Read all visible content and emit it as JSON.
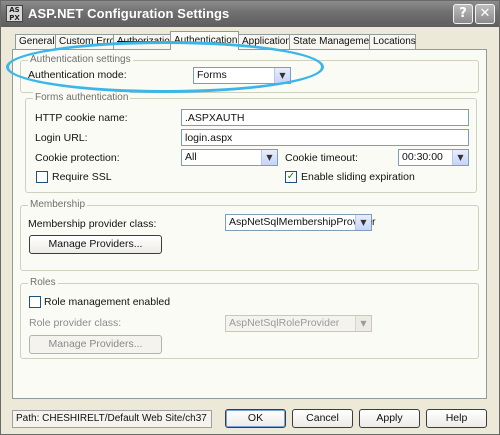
{
  "window": {
    "title": "ASP.NET Configuration Settings",
    "icon": "aspnet-icon",
    "help_label": "?",
    "close_label": "✕"
  },
  "tabs": [
    {
      "label": "General"
    },
    {
      "label": "Custom Errors"
    },
    {
      "label": "Authorization"
    },
    {
      "label": "Authentication",
      "active": true
    },
    {
      "label": "Application"
    },
    {
      "label": "State Management"
    },
    {
      "label": "Locations"
    }
  ],
  "auth_settings": {
    "group_title": "Authentication settings",
    "mode_label": "Authentication mode:",
    "mode_value": "Forms"
  },
  "forms_auth": {
    "group_title": "Forms authentication",
    "cookie_name_label": "HTTP cookie name:",
    "cookie_name_value": ".ASPXAUTH",
    "login_url_label": "Login URL:",
    "login_url_value": "login.aspx",
    "cookie_protection_label": "Cookie protection:",
    "cookie_protection_value": "All",
    "cookie_timeout_label": "Cookie timeout:",
    "cookie_timeout_value": "00:30:00",
    "require_ssl_label": "Require SSL",
    "require_ssl_checked": false,
    "sliding_expiration_label": "Enable sliding expiration",
    "sliding_expiration_checked": true,
    "check_mark": "✓"
  },
  "membership": {
    "group_title": "Membership",
    "provider_class_label": "Membership provider class:",
    "provider_class_value": "AspNetSqlMembershipProvider",
    "manage_label": "Manage Providers..."
  },
  "roles": {
    "group_title": "Roles",
    "enabled_label": "Role management enabled",
    "enabled_checked": false,
    "provider_class_label": "Role provider class:",
    "provider_class_value": "AspNetSqlRoleProvider",
    "manage_label": "Manage Providers..."
  },
  "footer": {
    "path_text": "Path: CHESHIRELT/Default Web Site/ch37",
    "ok_label": "OK",
    "cancel_label": "Cancel",
    "apply_label": "Apply",
    "help_label": "Help"
  },
  "colors": {
    "highlight_ellipse": "#3bb6e8",
    "titlebar": "#6f6f6f",
    "dialog_bg": "#ece9d8"
  }
}
